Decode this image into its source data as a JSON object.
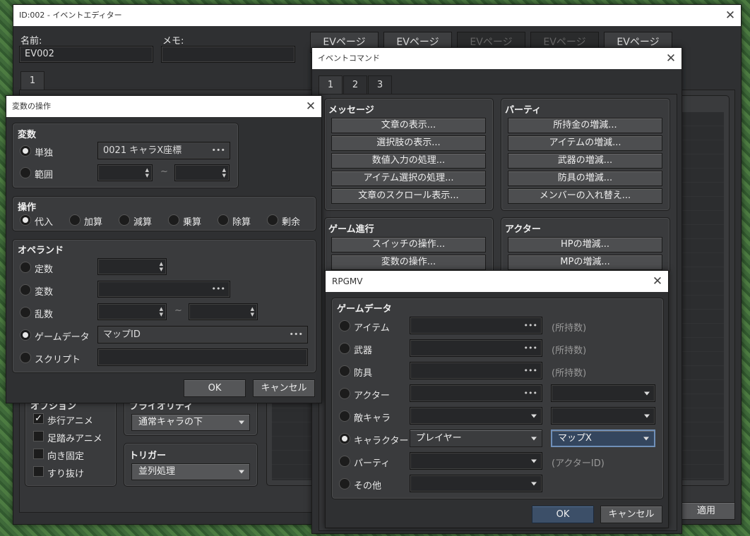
{
  "event_editor": {
    "title": "ID:002 - イベントエディター",
    "name_label": "名前:",
    "name_value": "EV002",
    "memo_label": "メモ:",
    "memo_value": "",
    "tab": "1",
    "ev_tabs": [
      "EVページ",
      "EVページ",
      "EVページ",
      "EVページ",
      "EVページ"
    ],
    "options_title": "オプション",
    "options": [
      {
        "label": "歩行アニメ",
        "checked": true
      },
      {
        "label": "足踏みアニメ",
        "checked": false
      },
      {
        "label": "向き固定",
        "checked": false
      },
      {
        "label": "すり抜け",
        "checked": false
      }
    ],
    "priority_title": "プライオリティ",
    "priority_value": "通常キャラの下",
    "trigger_title": "トリガー",
    "trigger_value": "並列処理",
    "apply_label": "適用"
  },
  "event_command": {
    "title": "イベントコマンド",
    "tabs": [
      "1",
      "2",
      "3"
    ],
    "message": {
      "title": "メッセージ",
      "items": [
        "文章の表示...",
        "選択肢の表示...",
        "数値入力の処理...",
        "アイテム選択の処理...",
        "文章のスクロール表示..."
      ]
    },
    "party": {
      "title": "パーティ",
      "items": [
        "所持金の増減...",
        "アイテムの増減...",
        "武器の増減...",
        "防具の増減...",
        "メンバーの入れ替え..."
      ]
    },
    "game_progress": {
      "title": "ゲーム進行",
      "items": [
        "スイッチの操作...",
        "変数の操作..."
      ]
    },
    "actor": {
      "title": "アクター",
      "items": [
        "HPの増減...",
        "MPの増減..."
      ]
    }
  },
  "variable_op": {
    "title": "変数の操作",
    "variable": {
      "title": "変数",
      "single_label": "単独",
      "single_value": "0021 キャラX座標",
      "range_label": "範囲",
      "range_sep": "~"
    },
    "operation": {
      "title": "操作",
      "items": [
        {
          "label": "代入",
          "on": true
        },
        {
          "label": "加算",
          "on": false
        },
        {
          "label": "減算",
          "on": false
        },
        {
          "label": "乗算",
          "on": false
        },
        {
          "label": "除算",
          "on": false
        },
        {
          "label": "剰余",
          "on": false
        }
      ]
    },
    "operand": {
      "title": "オペランド",
      "constant": "定数",
      "variable": "変数",
      "random": "乱数",
      "random_sep": "~",
      "game_data": "ゲームデータ",
      "game_data_value": "マップID",
      "script": "スクリプト"
    },
    "ok": "OK",
    "cancel": "キャンセル"
  },
  "rpgmv": {
    "title": "RPGMV",
    "group_title": "ゲームデータ",
    "rows": {
      "item": "アイテム",
      "weapon": "武器",
      "armor": "防具",
      "actor": "アクター",
      "enemy": "敵キャラ",
      "character": "キャラクター",
      "party": "パーティ",
      "other": "その他"
    },
    "owned": "(所持数)",
    "actor_id": "(アクターID)",
    "character_value": "プレイヤー",
    "character_prop": "マップX",
    "ok": "OK",
    "cancel": "キャンセル"
  },
  "colors": {
    "window_bg": "#2f3032",
    "group_bg": "#3a3b3d",
    "title_bar": "#ffffff",
    "accent": "#3c4f68"
  }
}
